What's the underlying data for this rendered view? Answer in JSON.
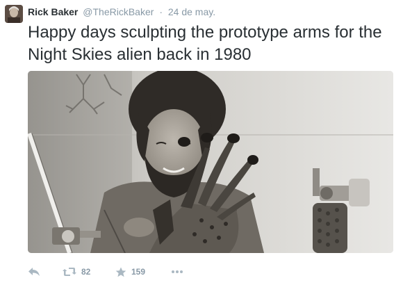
{
  "tweet": {
    "fullname": "Rick Baker",
    "username": "@TheRickBaker",
    "separator": "·",
    "time": "24 de may.",
    "text": "Happy days sculpting the prototype arms for the Night Skies alien back in 1980"
  },
  "actions": {
    "retweet_count": "82",
    "favorite_count": "159"
  },
  "colors": {
    "name": "#292f33",
    "meta": "#8899a6",
    "action_icon": "#aab8c2"
  },
  "icons": [
    "reply-icon",
    "retweet-icon",
    "favorite-star-icon",
    "more-dots-icon"
  ]
}
